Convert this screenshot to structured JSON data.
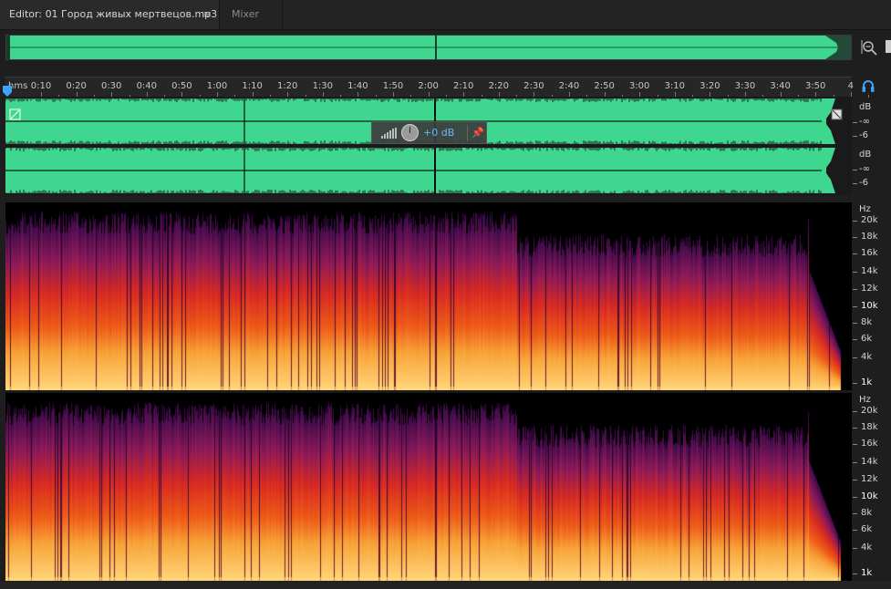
{
  "tabs": {
    "editor_label": "Editor: 01 Город живых мертвецов.mp3",
    "editor_menu": "≡",
    "mixer_label": "Mixer"
  },
  "ruler": {
    "unit_label": "hms",
    "ticks": [
      "0:10",
      "0:20",
      "0:30",
      "0:40",
      "0:50",
      "1:00",
      "1:10",
      "1:20",
      "1:30",
      "1:40",
      "1:50",
      "2:00",
      "2:10",
      "2:20",
      "2:30",
      "2:40",
      "2:50",
      "3:00",
      "3:10",
      "3:20",
      "3:30",
      "3:40",
      "3:50",
      "4"
    ]
  },
  "amplitude_scale": {
    "top": [
      "dB",
      "-∞",
      "-6"
    ],
    "bottom": [
      "dB",
      "-∞",
      "-6"
    ]
  },
  "gain_hud": {
    "value": "+0 dB",
    "pin_icon": "pin-icon"
  },
  "frequency_scale": {
    "unit": "Hz",
    "labels": [
      "20k",
      "18k",
      "16k",
      "14k",
      "12k",
      "10k",
      "8k",
      "6k",
      "4k",
      "1k"
    ]
  },
  "colors": {
    "waveform": "#3fd690",
    "waveform_dark": "#2fb077",
    "accent_blue": "#3aa4ff",
    "spectral_hot": "#ffd166",
    "spectral_mid": "#e5301a",
    "spectral_low": "#5a1a6a"
  },
  "icons": [
    "zoom-in-vertical-icon",
    "headphones-icon",
    "playhead-marker-icon",
    "level-meter-icon",
    "gain-knob-icon",
    "pin-icon",
    "fade-in-handle-icon",
    "fade-out-handle-icon"
  ]
}
